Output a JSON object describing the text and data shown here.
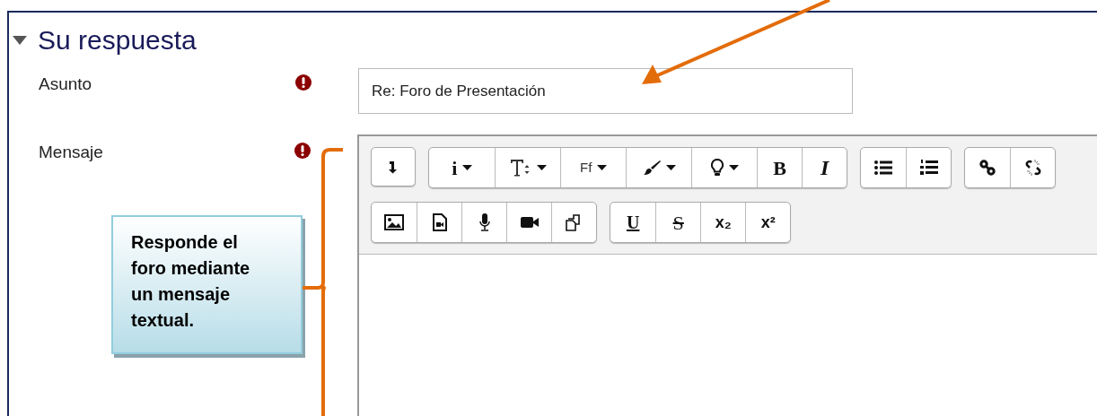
{
  "section": {
    "title": "Su respuesta",
    "expanded": true
  },
  "fields": [
    {
      "label": "Asunto",
      "required": true,
      "value": "Re: Foro de Presentación"
    },
    {
      "label": "Mensaje",
      "required": true
    }
  ],
  "toolbar": {
    "rows": [
      [
        [
          {
            "kind": "expand-toolbar"
          }
        ],
        [
          {
            "kind": "info",
            "label": "i",
            "dropdown": true
          },
          {
            "kind": "font-size",
            "dropdown": true
          },
          {
            "kind": "font-family",
            "label": "Ff",
            "dropdown": true
          },
          {
            "kind": "brush",
            "dropdown": true
          },
          {
            "kind": "bulb",
            "dropdown": true
          },
          {
            "kind": "bold",
            "label": "B"
          },
          {
            "kind": "italic",
            "label": "I"
          }
        ],
        [
          {
            "kind": "bullet-list"
          },
          {
            "kind": "numbered-list"
          }
        ],
        [
          {
            "kind": "link"
          },
          {
            "kind": "unlink"
          }
        ]
      ],
      [
        [
          {
            "kind": "image"
          },
          {
            "kind": "media"
          },
          {
            "kind": "microphone"
          },
          {
            "kind": "video"
          },
          {
            "kind": "copy"
          }
        ],
        [
          {
            "kind": "underline",
            "label": "U"
          },
          {
            "kind": "strike",
            "label": "S"
          },
          {
            "kind": "subscript",
            "label": "x₂"
          },
          {
            "kind": "superscript",
            "label": "x²"
          }
        ]
      ]
    ]
  },
  "callout": {
    "text": "Responde el foro mediante un mensaje textual."
  }
}
